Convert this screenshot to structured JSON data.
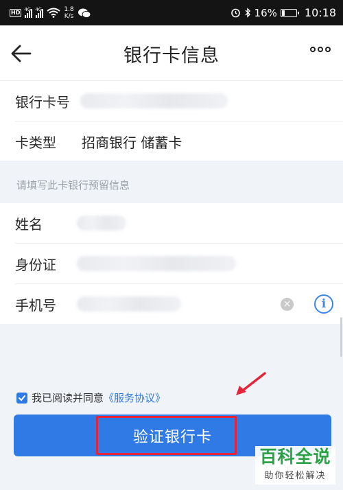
{
  "status_bar": {
    "hd": "HD",
    "net_left": "4G",
    "net_right": "4G",
    "speed_value": "1.8",
    "speed_unit": "K/s",
    "battery": "16%",
    "time": "10:18"
  },
  "header": {
    "title": "银行卡信息"
  },
  "card_info": {
    "number_label": "银行卡号",
    "type_label": "卡类型",
    "type_value": "招商银行 储蓄卡"
  },
  "section_hint": "请填写此卡银行预留信息",
  "personal": {
    "name_label": "姓名",
    "id_label": "身份证",
    "phone_label": "手机号",
    "clear_glyph": "×",
    "info_glyph": "i"
  },
  "agreement": {
    "text": "我已阅读并同意",
    "link": "《服务协议》",
    "checked": true
  },
  "verify_button": {
    "label": "验证银行卡"
  },
  "watermark": {
    "title": "百科全说",
    "subtitle": "助你轻松解决"
  },
  "colors": {
    "primary": "#2f7ae5",
    "annotation_red": "#e4243a",
    "watermark_green": "#2ba245"
  }
}
